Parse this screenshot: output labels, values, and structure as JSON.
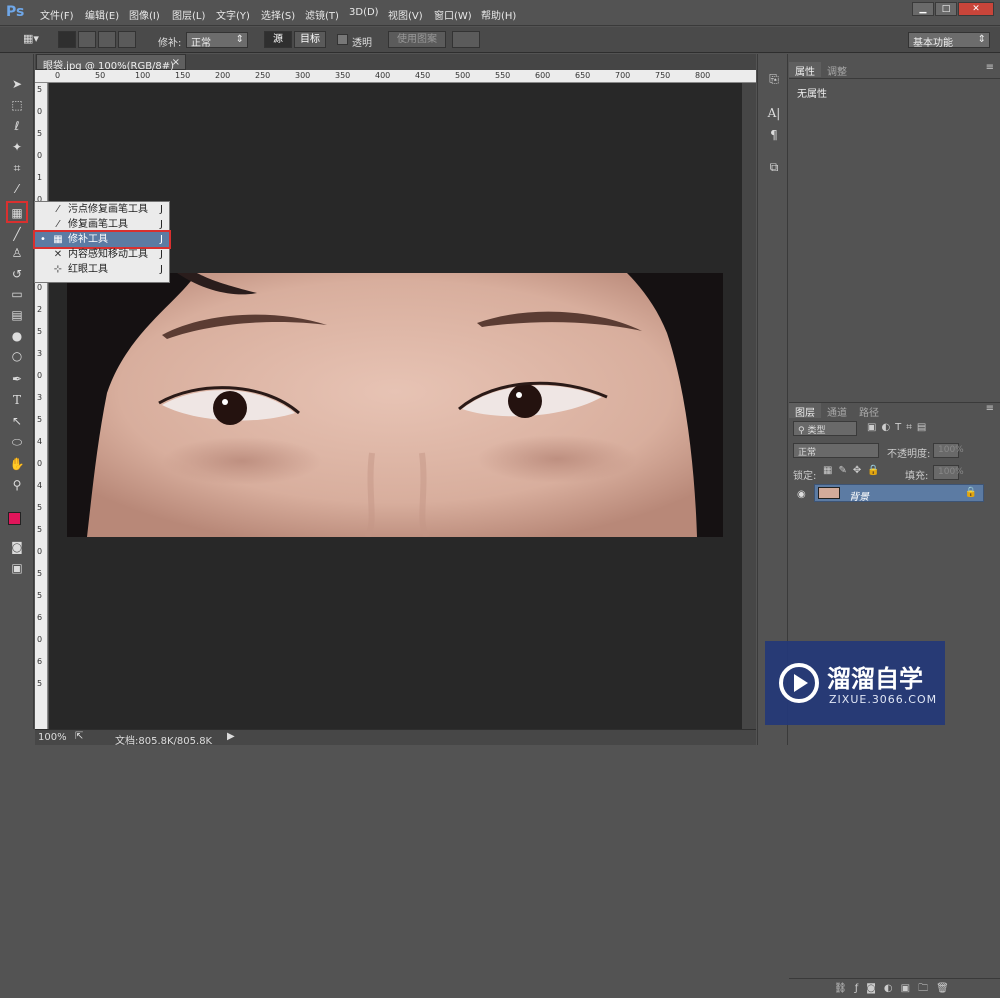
{
  "app": {
    "logo": "Ps"
  },
  "menubar": {
    "items": [
      "文件(F)",
      "编辑(E)",
      "图像(I)",
      "图层(L)",
      "文字(Y)",
      "选择(S)",
      "滤镜(T)",
      "3D(D)",
      "视图(V)",
      "窗口(W)",
      "帮助(H)"
    ],
    "window_buttons": [
      "▁",
      "□",
      "✕"
    ]
  },
  "options_bar": {
    "patch_label": "修补:",
    "patch_mode": "正常",
    "source_label": "源",
    "target_label": "目标",
    "transparent_label": "透明",
    "use_pattern_label": "使用图案",
    "workspace": "基本功能"
  },
  "document": {
    "tab_title": "眼袋.jpg @ 100%(RGB/8#) *",
    "ruler_h_ticks": [
      "0",
      "50",
      "100",
      "150",
      "200",
      "250",
      "300",
      "350",
      "400",
      "450",
      "500",
      "550",
      "600",
      "650",
      "700",
      "750",
      "800"
    ],
    "ruler_v_ticks": [
      "5",
      "0",
      "5",
      "0",
      "1",
      "0",
      "1",
      "5",
      "2",
      "0",
      "2",
      "5",
      "3",
      "0",
      "3",
      "5",
      "4",
      "0",
      "4",
      "5",
      "5",
      "0",
      "5",
      "5",
      "6",
      "0",
      "6",
      "5"
    ]
  },
  "status_bar": {
    "zoom": "100%",
    "doc_info": "文档:805.8K/805.8K"
  },
  "flyout_menu": {
    "items": [
      {
        "label": "污点修复画笔工具",
        "key": "J",
        "icon": "bandage-icon",
        "selected": false
      },
      {
        "label": "修复画笔工具",
        "key": "J",
        "icon": "bandage-icon",
        "selected": false
      },
      {
        "label": "修补工具",
        "key": "J",
        "icon": "patch-icon",
        "selected": true
      },
      {
        "label": "内容感知移动工具",
        "key": "J",
        "icon": "move-arrows-icon",
        "selected": false
      },
      {
        "label": "红眼工具",
        "key": "J",
        "icon": "eye-icon",
        "selected": false
      }
    ]
  },
  "properties_panel": {
    "tabs": [
      "属性",
      "调整"
    ],
    "empty_text": "无属性"
  },
  "layers_panel": {
    "tabs": [
      "图层",
      "通道",
      "路径"
    ],
    "filter_label": "类型",
    "blend_mode": "正常",
    "opacity_label": "不透明度:",
    "opacity_value": "100%",
    "lock_label": "锁定:",
    "fill_label": "填充:",
    "fill_value": "100%",
    "layer_name": "背景"
  },
  "watermark": {
    "title": "溜溜自学",
    "url": "ZIXUE.3066.COM"
  },
  "colors": {
    "highlight_red": "#d9302f",
    "selection_blue": "#5c7ba3",
    "foreground": "#e0155a",
    "background": "#ffffff"
  }
}
